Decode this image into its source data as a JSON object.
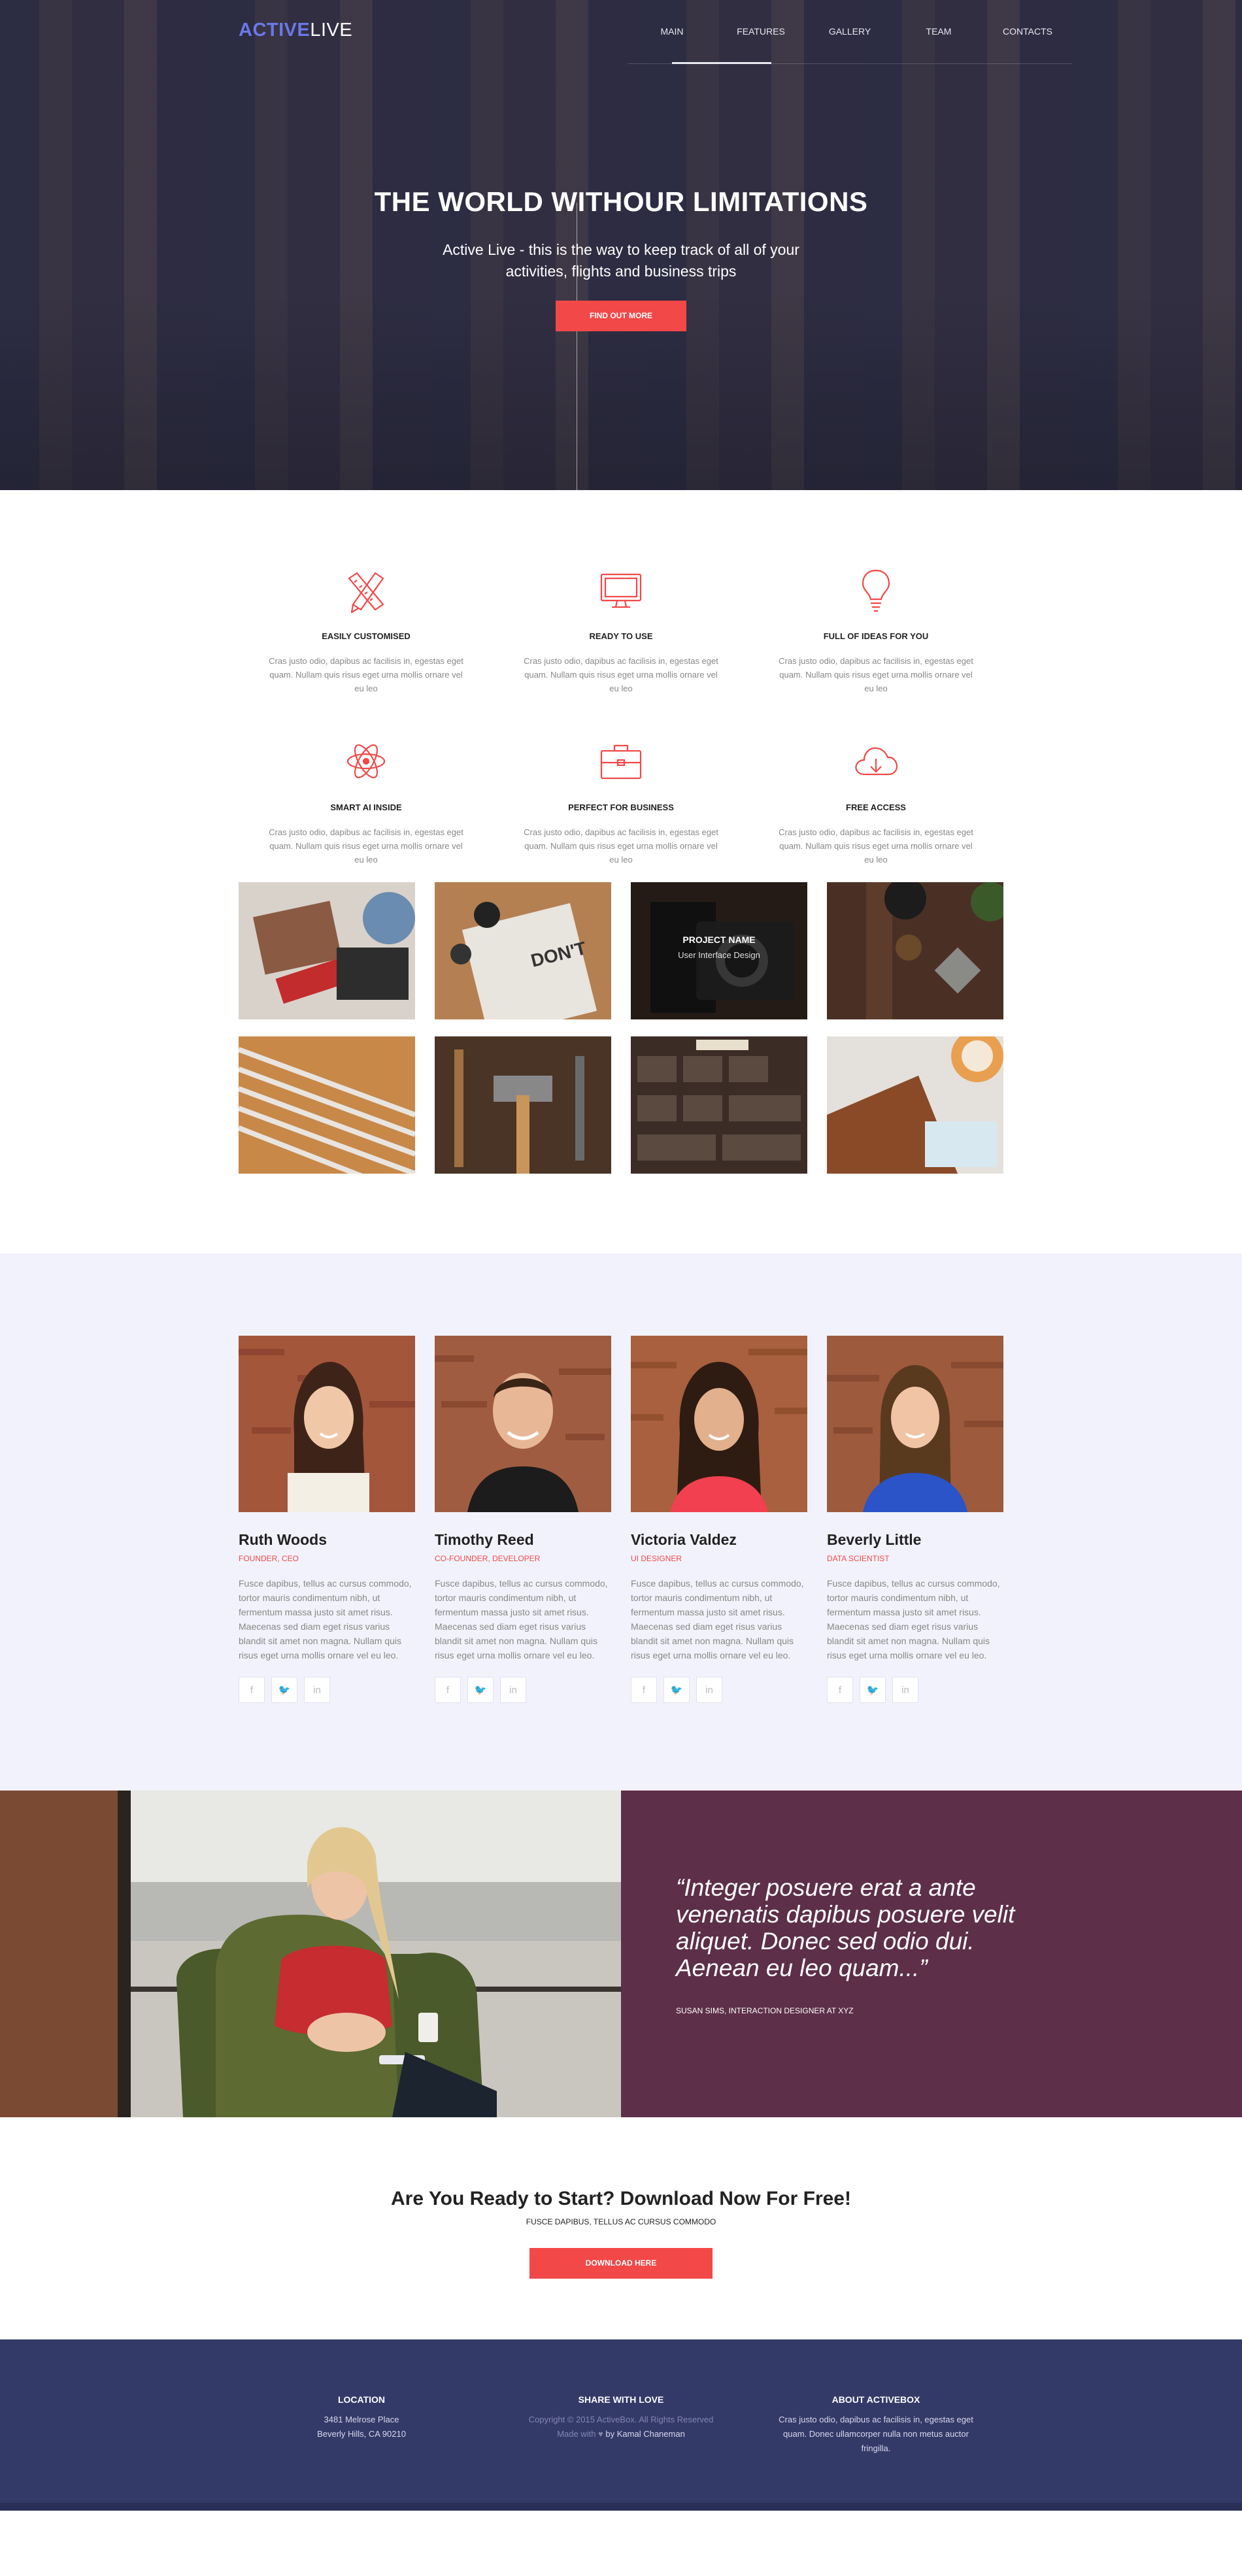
{
  "nav": {
    "logo_a": "ACTIVE",
    "logo_b": "LIVE",
    "items": [
      "MAIN",
      "FEATURES",
      "GALLERY",
      "TEAM",
      "CONTACTS"
    ],
    "active": "FEATURES"
  },
  "hero": {
    "title": "THE WORLD WITHOUR LIMITATIONS",
    "subtitle": "Active Live - this is the way to keep track of all of your activities, flights and business trips",
    "button": "FIND OUT MORE"
  },
  "features": [
    {
      "icon": "pencil-ruler-icon",
      "title": "EASILY CUSTOMISED",
      "text": "Cras justo odio, dapibus ac facilisis in, egestas eget quam. Nullam quis risus eget urna mollis ornare vel eu leo"
    },
    {
      "icon": "monitor-icon",
      "title": "READY TO USE",
      "text": "Cras justo odio, dapibus ac facilisis in, egestas eget quam. Nullam quis risus eget urna mollis ornare vel eu leo"
    },
    {
      "icon": "lightbulb-icon",
      "title": "FULL OF IDEAS FOR YOU",
      "text": "Cras justo odio, dapibus ac facilisis in, egestas eget quam. Nullam quis risus eget urna mollis ornare vel eu leo"
    },
    {
      "icon": "atom-icon",
      "title": "SMART AI INSIDE",
      "text": "Cras justo odio, dapibus ac facilisis in, egestas eget quam. Nullam quis risus eget urna mollis ornare vel eu leo"
    },
    {
      "icon": "briefcase-icon",
      "title": "PERFECT FOR BUSINESS",
      "text": "Cras justo odio, dapibus ac facilisis in, egestas eget quam. Nullam quis risus eget urna mollis ornare vel eu leo"
    },
    {
      "icon": "cloud-download-icon",
      "title": "FREE ACCESS",
      "text": "Cras justo odio, dapibus ac facilisis in, egestas eget quam. Nullam quis risus eget urna mollis ornare vel eu leo"
    }
  ],
  "gallery": {
    "caption_title": "PROJECT NAME",
    "caption_sub": "User Interface Design"
  },
  "team": [
    {
      "name": "Ruth Woods",
      "role": "FOUNDER, CEO",
      "bio": "Fusce dapibus, tellus ac cursus commodo, tortor mauris condimentum nibh, ut fermentum massa justo sit amet risus. Maecenas sed diam eget risus varius blandit sit amet non magna. Nullam quis risus eget urna mollis ornare vel eu leo."
    },
    {
      "name": "Timothy Reed",
      "role": "CO-FOUNDER, DEVELOPER",
      "bio": "Fusce dapibus, tellus ac cursus commodo, tortor mauris condimentum nibh, ut fermentum massa justo sit amet risus. Maecenas sed diam eget risus varius blandit sit amet non magna. Nullam quis risus eget urna mollis ornare vel eu leo."
    },
    {
      "name": "Victoria Valdez",
      "role": "UI DESIGNER",
      "bio": "Fusce dapibus, tellus ac cursus commodo, tortor mauris condimentum nibh, ut fermentum massa justo sit amet risus. Maecenas sed diam eget risus varius blandit sit amet non magna. Nullam quis risus eget urna mollis ornare vel eu leo."
    },
    {
      "name": "Beverly Little",
      "role": "DATA SCIENTIST",
      "bio": "Fusce dapibus, tellus ac cursus commodo, tortor mauris condimentum nibh, ut fermentum massa justo sit amet risus. Maecenas sed diam eget risus varius blandit sit amet non magna. Nullam quis risus eget urna mollis ornare vel eu leo."
    }
  ],
  "social": {
    "facebook": "f",
    "twitter": "🐦",
    "linkedin": "in"
  },
  "testimonial": {
    "quote": "“Integer posuere erat a ante venenatis dapibus posuere velit aliquet. Donec sed odio dui. Aenean eu leo quam...”",
    "author": "SUSAN SIMS, INTERACTION DESIGNER AT XYZ"
  },
  "cta": {
    "title": "Are You Ready to Start? Download Now For Free!",
    "subtitle": "FUSCE DAPIBUS, TELLUS AC CURSUS COMMODO",
    "button": "DOWNLOAD HERE"
  },
  "footer": {
    "location_title": "LOCATION",
    "location_line1": "3481 Melrose Place",
    "location_line2": "Beverly Hills, CA 90210",
    "share_title": "SHARE WITH LOVE",
    "copyright": "Copyright © 2015 ActiveBox. All Rights Reserved",
    "made_with": "Made with ♥",
    "made_by": "by Kamal Chaneman",
    "about_title": "ABOUT ACTIVEBOX",
    "about_text": "Cras justo odio, dapibus ac facilisis in, egestas eget quam. Donec ullamcorper nulla non metus auctor fringilla."
  },
  "colors": {
    "accent": "#f24848",
    "brand_blue": "#6a78e8",
    "team_bg": "#f2f2fc",
    "testimonial_bg": "#5d2f48",
    "footer_bg": "#343a68"
  }
}
